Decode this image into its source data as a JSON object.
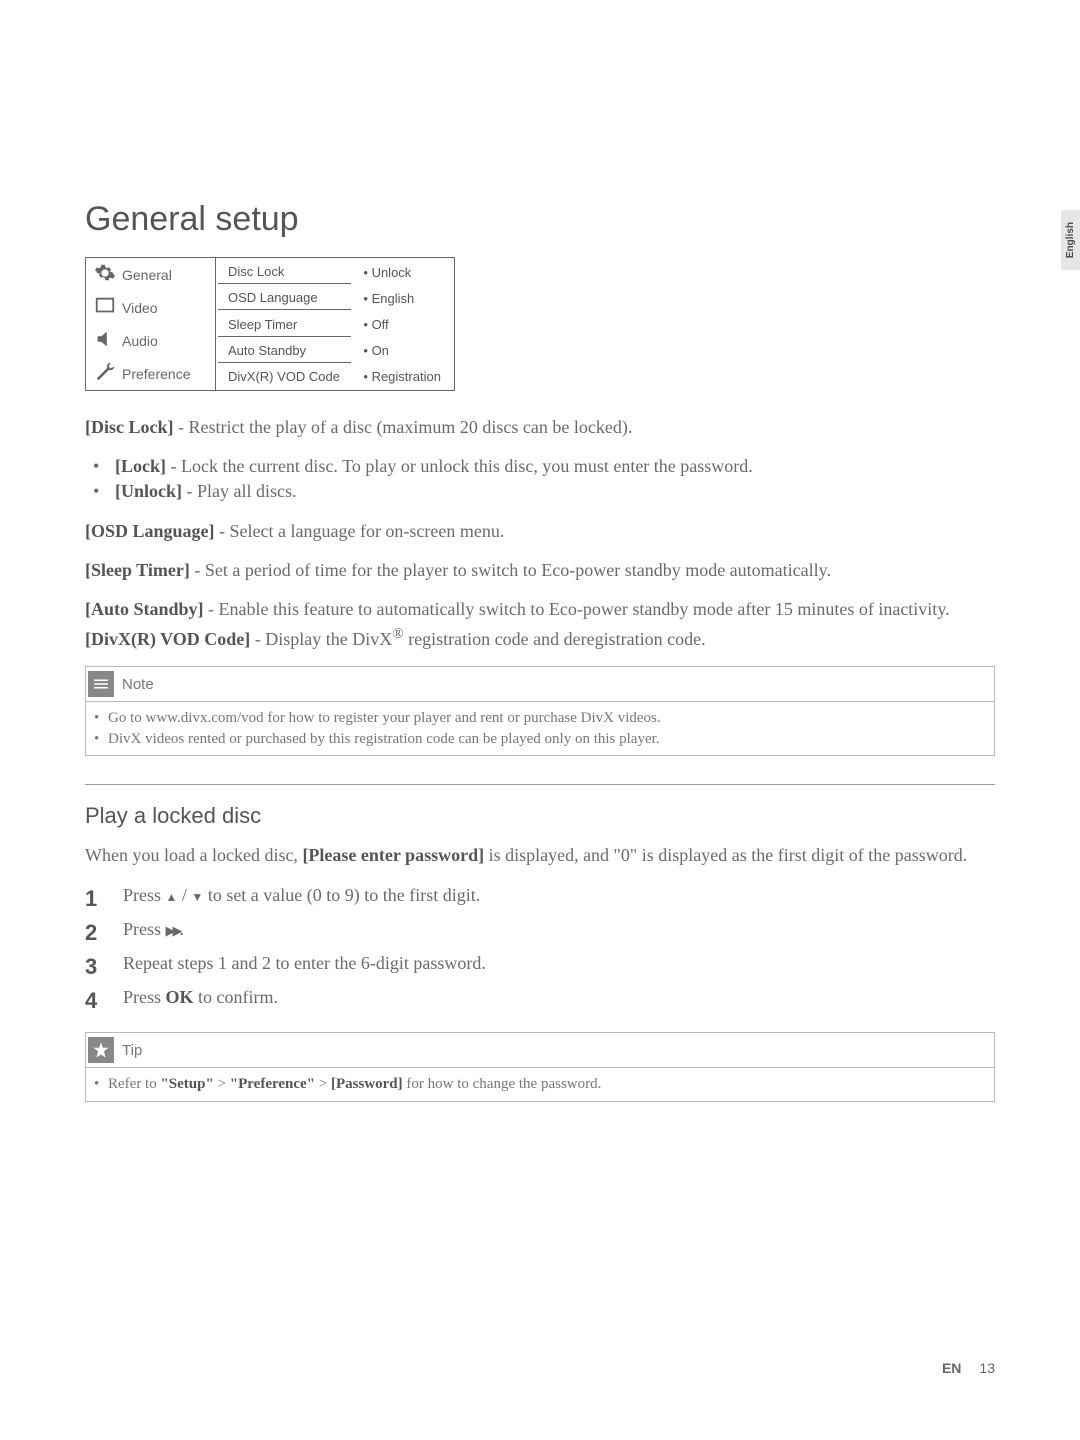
{
  "side_tab": "English",
  "heading": "General setup",
  "sidebar": {
    "items": [
      {
        "label": "General"
      },
      {
        "label": "Video"
      },
      {
        "label": "Audio"
      },
      {
        "label": "Preference"
      }
    ]
  },
  "settings": [
    {
      "name": "Disc Lock",
      "value": "Unlock"
    },
    {
      "name": "OSD Language",
      "value": "English"
    },
    {
      "name": "Sleep Timer",
      "value": "Off"
    },
    {
      "name": "Auto Standby",
      "value": "On"
    },
    {
      "name": "DivX(R) VOD Code",
      "value": "Registration"
    }
  ],
  "disc_lock": {
    "lead": "[Disc Lock]",
    "desc": " - Restrict the play of a disc (maximum 20 discs can be locked).",
    "lock_lead": "[Lock]",
    "lock_desc": " - Lock the current disc. To play or unlock this disc, you must enter the password.",
    "unlock_lead": "[Unlock]",
    "unlock_desc": " - Play all discs."
  },
  "osd_lang": {
    "lead": "[OSD Language]",
    "desc": " - Select a language for on-screen menu."
  },
  "sleep_timer": {
    "lead": "[Sleep Timer]",
    "desc": " - Set a period of time for the player to switch to Eco-power standby mode automatically."
  },
  "auto_standby": {
    "lead": "[Auto Standby]",
    "desc": " - Enable this feature to automatically switch to Eco-power standby mode after 15 minutes of inactivity."
  },
  "divx": {
    "lead": "[DivX(R) VOD Code]",
    "desc_pre": " - Display the DivX",
    "reg": "®",
    "desc_post": " registration code and deregistration code."
  },
  "note": {
    "title": "Note",
    "items": [
      "Go to www.divx.com/vod for how to register your player and rent or purchase DivX videos.",
      "DivX videos rented or purchased by this registration code can be played only on this player."
    ]
  },
  "play_locked": {
    "heading": "Play a locked disc",
    "intro_pre": "When you load a locked disc, ",
    "intro_bold": "[Please enter password]",
    "intro_post": " is displayed, and \"0\" is displayed as the first digit of the password.",
    "steps": {
      "s1_pre": "Press ",
      "s1_post": " to set a value (0 to 9) to the first digit.",
      "s2_pre": "Press ",
      "s2_post": ".",
      "s3": "Repeat steps 1 and 2 to enter the 6-digit password.",
      "s4_pre": "Press ",
      "s4_ok": "OK",
      "s4_post": " to confirm."
    }
  },
  "tip": {
    "title": "Tip",
    "text_pre": "Refer to ",
    "q1": "\"Setup\"",
    "gt1": " > ",
    "q2": "\"Preference\"",
    "gt2": " > ",
    "q3": "[Password]",
    "text_post": " for how to change the password."
  },
  "footer": {
    "en": "EN",
    "page": "13"
  }
}
